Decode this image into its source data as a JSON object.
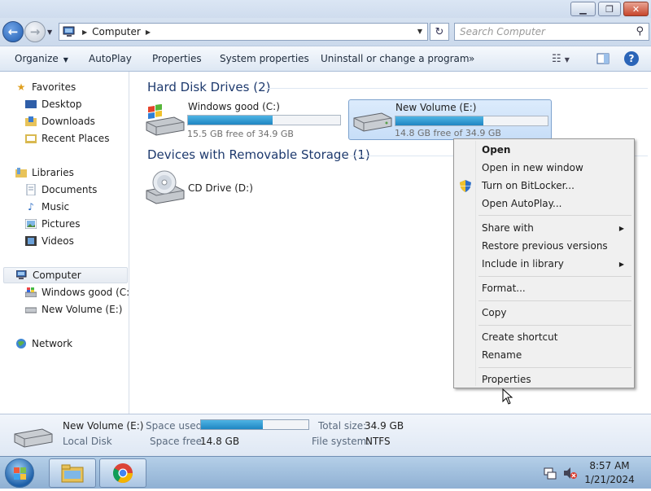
{
  "window": {
    "title_buttons": [
      "minimize",
      "restore",
      "close"
    ]
  },
  "address": {
    "breadcrumb": "Computer",
    "search_placeholder": "Search Computer"
  },
  "toolbar": {
    "organize": "Organize",
    "autoplay": "AutoPlay",
    "properties": "Properties",
    "system_properties": "System properties",
    "uninstall": "Uninstall or change a program",
    "more": "»"
  },
  "nav": {
    "favorites": "Favorites",
    "desktop": "Desktop",
    "downloads": "Downloads",
    "recent_places": "Recent Places",
    "libraries": "Libraries",
    "documents": "Documents",
    "music": "Music",
    "pictures": "Pictures",
    "videos": "Videos",
    "computer": "Computer",
    "windows_good": "Windows good (C:)",
    "new_volume": "New Volume (E:)",
    "network": "Network"
  },
  "groups": {
    "hdd": "Hard Disk Drives (2)",
    "removable": "Devices with Removable Storage (1)"
  },
  "drives": [
    {
      "name": "Windows good (C:)",
      "free": "15.5 GB free of 34.9 GB",
      "used_fraction": 0.556
    },
    {
      "name": "New Volume (E:)",
      "free": "14.8 GB free of 34.9 GB",
      "used_fraction": 0.576
    },
    {
      "name": "CD Drive (D:)"
    }
  ],
  "context_menu": {
    "open": "Open",
    "open_new_window": "Open in new window",
    "bitlocker": "Turn on BitLocker...",
    "open_autoplay": "Open AutoPlay...",
    "share_with": "Share with",
    "restore_prev": "Restore previous versions",
    "include_library": "Include in library",
    "format": "Format...",
    "copy": "Copy",
    "create_shortcut": "Create shortcut",
    "rename": "Rename",
    "properties": "Properties"
  },
  "details": {
    "name": "New Volume (E:)",
    "type": "Local Disk",
    "space_used_label": "Space used:",
    "space_free_label": "Space free:",
    "space_free": "14.8 GB",
    "total_size_label": "Total size:",
    "total_size": "34.9 GB",
    "filesystem_label": "File system:",
    "filesystem": "NTFS",
    "used_fraction": 0.576
  },
  "taskbar": {
    "time": "8:57 AM",
    "date": "1/21/2024"
  }
}
